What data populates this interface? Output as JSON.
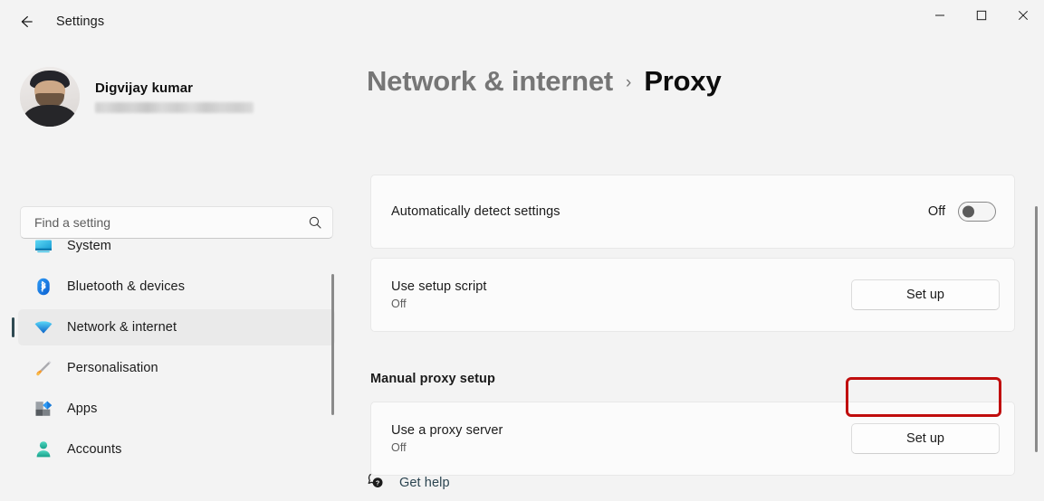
{
  "window": {
    "title": "Settings",
    "back_icon": "back-arrow-icon",
    "minimize_label": "Minimize",
    "maximize_label": "Maximize",
    "close_label": "Close"
  },
  "account": {
    "name": "Digvijay kumar",
    "email_redacted": "",
    "avatar_icon": "user-avatar-photo"
  },
  "search": {
    "placeholder": "Find a setting",
    "value": "",
    "icon": "search-icon"
  },
  "sidebar": {
    "items": [
      {
        "label": "System",
        "icon": "monitor-icon",
        "selected": false
      },
      {
        "label": "Bluetooth & devices",
        "icon": "bluetooth-icon",
        "selected": false
      },
      {
        "label": "Network & internet",
        "icon": "wifi-icon",
        "selected": true
      },
      {
        "label": "Personalisation",
        "icon": "paintbrush-icon",
        "selected": false
      },
      {
        "label": "Apps",
        "icon": "apps-grid-icon",
        "selected": false
      },
      {
        "label": "Accounts",
        "icon": "person-icon",
        "selected": false
      }
    ]
  },
  "breadcrumb": {
    "parent": "Network & internet",
    "separator": "›",
    "current": "Proxy"
  },
  "main": {
    "auto_detect": {
      "title": "Automatically detect settings",
      "toggle_state": "Off"
    },
    "setup_script": {
      "title": "Use setup script",
      "status": "Off",
      "button_label": "Set up"
    },
    "manual_section_title": "Manual proxy setup",
    "proxy_server": {
      "title": "Use a proxy server",
      "status": "Off",
      "button_label": "Set up"
    },
    "get_help": {
      "label": "Get help",
      "icon": "help-bubble-icon"
    }
  },
  "annotation": {
    "color": "#c00d0d",
    "target": "proxy-server-set-up-button"
  },
  "colors": {
    "page_background": "#f3f3f3",
    "card_background": "#fbfbfb",
    "selected_accent": "#2f4a52",
    "link_text": "#2b4450"
  }
}
